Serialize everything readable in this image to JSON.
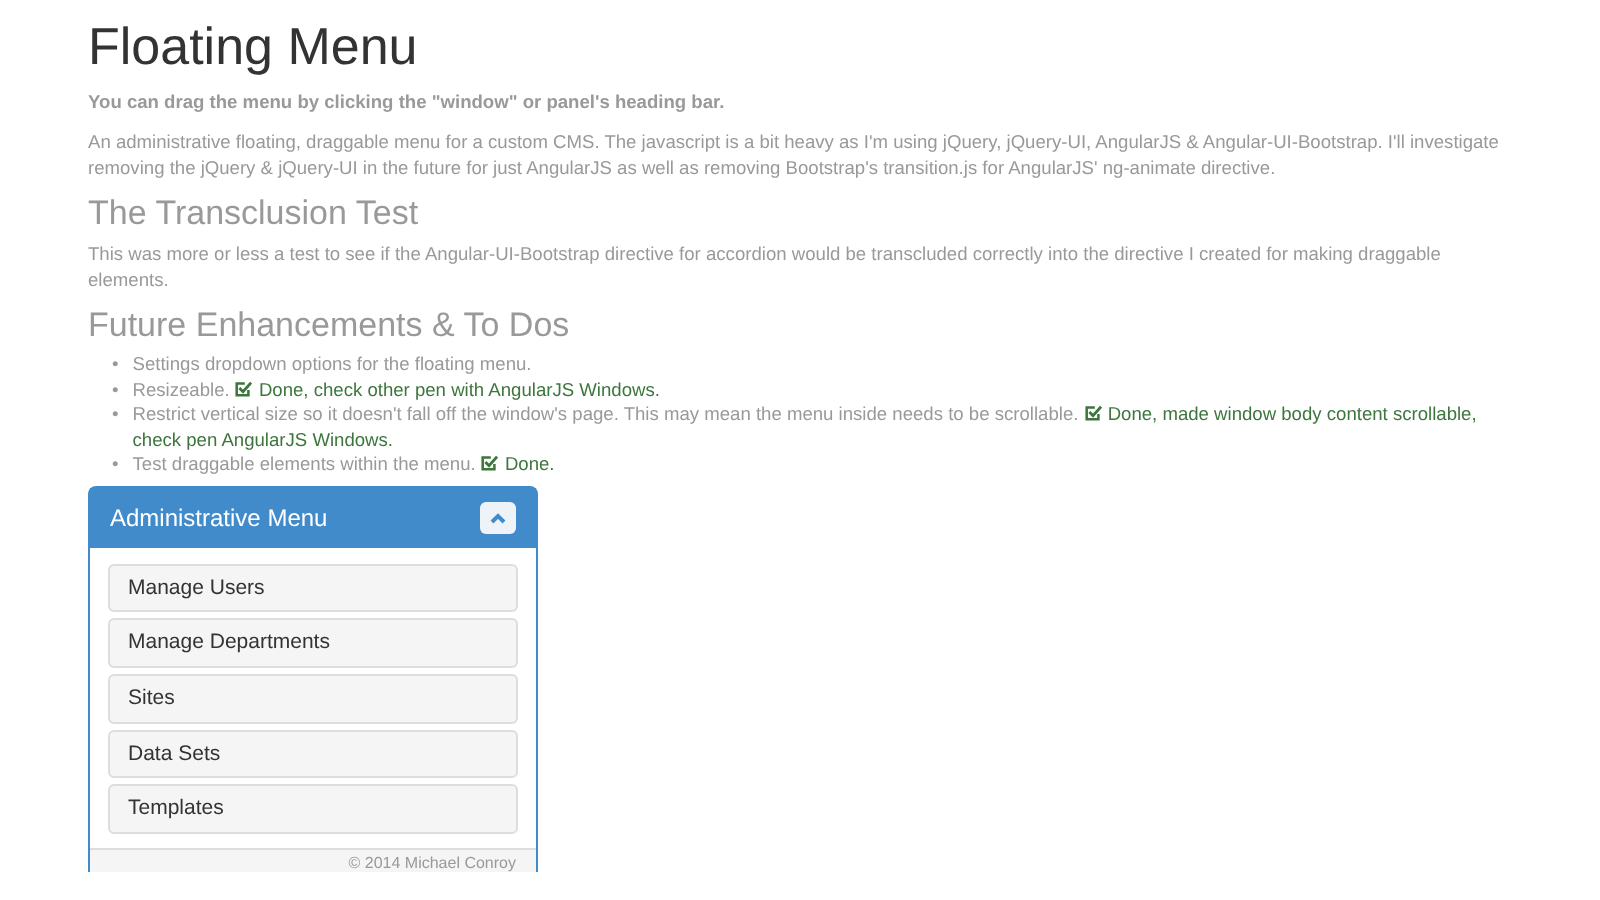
{
  "title": "Floating Menu",
  "lead": "You can drag the menu by clicking the \"window\" or panel's heading bar.",
  "intro": "An administrative floating, draggable menu for a custom CMS. The javascript is a bit heavy as I'm using jQuery, jQuery-UI, AngularJS & Angular-UI-Bootstrap. I'll investigate removing the jQuery & jQuery-UI in the future for just AngularJS as well as removing Bootstrap's transition.js for AngularJS' ng-animate directive.",
  "sections": [
    {
      "heading": "The Transclusion Test",
      "text": "This was more or less a test to see if the Angular-UI-Bootstrap directive for accordion would be transcluded correctly into the directive I created for making draggable elements."
    },
    {
      "heading": "Future Enhancements & To Dos",
      "bullet": "•",
      "todos": [
        {
          "text": "Settings dropdown options for the floating menu."
        },
        {
          "text": "Resizeable.",
          "done": "Done, check other pen with AngularJS Windows."
        },
        {
          "text": "Restrict vertical size so it doesn't fall off the window's page. This may mean the menu inside needs to be scrollable.",
          "done": "Done, made window body content scrollable, check pen AngularJS Windows."
        },
        {
          "text": "Test draggable elements within the menu.",
          "done": "Done."
        }
      ]
    }
  ],
  "panel": {
    "title": "Administrative Menu",
    "expanded": true,
    "items": [
      "Manage Users",
      "Manage Departments",
      "Sites",
      "Data Sets",
      "Templates"
    ],
    "footer": "© 2014 Michael Conroy"
  }
}
